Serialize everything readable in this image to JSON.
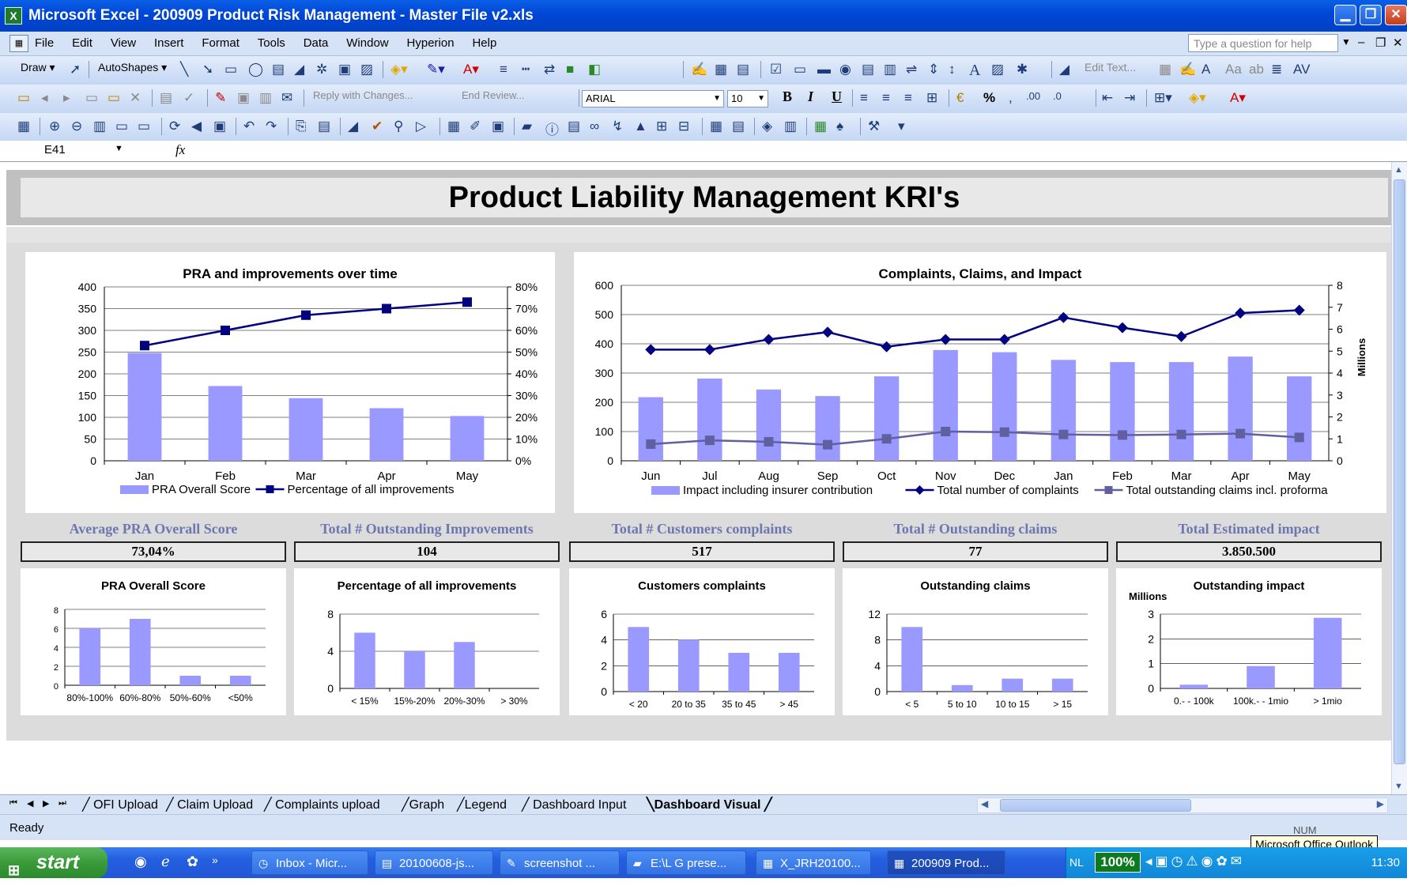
{
  "window": {
    "title": "Microsoft Excel - 200909 Product Risk Management - Master File v2.xls"
  },
  "menu": {
    "items": [
      "File",
      "Edit",
      "View",
      "Insert",
      "Format",
      "Tools",
      "Data",
      "Window",
      "Hyperion",
      "Help"
    ],
    "help_placeholder": "Type a question for help"
  },
  "toolbar": {
    "draw_label": "Draw",
    "autoshapes_label": "AutoShapes",
    "edit_text_label": "Edit Text...",
    "reply_label": "Reply with Changes...",
    "end_review_label": "End Review...",
    "font_name": "ARIAL",
    "font_size": "10",
    "bold_label": "B",
    "italic_label": "I",
    "underline_label": "U",
    "percent_label": "%"
  },
  "formula_bar": {
    "name_box": "E41",
    "fx_label": "fx"
  },
  "dashboard": {
    "title": "Product Liability Management KRI's",
    "kpis": [
      {
        "label": "Average PRA Overall Score",
        "value": "73,04%"
      },
      {
        "label": "Total # Outstanding Improvements",
        "value": "104"
      },
      {
        "label": "Total # Customers complaints",
        "value": "517"
      },
      {
        "label": "Total # Outstanding claims",
        "value": "77"
      },
      {
        "label": "Total Estimated impact",
        "value": "3.850.500"
      }
    ]
  },
  "chart_data": [
    {
      "id": "pra",
      "type": "bar+line",
      "title": "PRA and improvements over time",
      "categories": [
        "Jan",
        "Feb",
        "Mar",
        "Apr",
        "May"
      ],
      "series": [
        {
          "name": "PRA Overall Score",
          "type": "bar",
          "axis": "left",
          "values": [
            248,
            172,
            144,
            121,
            103
          ],
          "color": "#9999ff"
        },
        {
          "name": "Percentage of all improvements",
          "type": "line",
          "axis": "right",
          "values": [
            0.53,
            0.6,
            0.67,
            0.7,
            0.73
          ],
          "color": "#000080"
        }
      ],
      "y_left": {
        "min": 0,
        "max": 400,
        "step": 50,
        "ticks": [
          "0",
          "50",
          "100",
          "150",
          "200",
          "250",
          "300",
          "350",
          "400"
        ]
      },
      "y_right": {
        "min": 0,
        "max": 0.8,
        "step": 0.1,
        "ticks": [
          "0%",
          "10%",
          "20%",
          "30%",
          "40%",
          "50%",
          "60%",
          "70%",
          "80%"
        ]
      },
      "legend": "bottom"
    },
    {
      "id": "complaints",
      "type": "bar+line",
      "title": "Complaints, Claims, and Impact",
      "categories": [
        "Jun",
        "Jul",
        "Aug",
        "Sep",
        "Oct",
        "Nov",
        "Dec",
        "Jan",
        "Feb",
        "Mar",
        "Apr",
        "May"
      ],
      "series": [
        {
          "name": "Impact including insurer contribution",
          "type": "bar",
          "axis": "right",
          "values": [
            2.9,
            3.75,
            3.25,
            2.95,
            3.85,
            5.05,
            4.95,
            4.6,
            4.5,
            4.5,
            4.75,
            3.85
          ],
          "color": "#9999ff"
        },
        {
          "name": "Total number of complaints",
          "type": "line",
          "axis": "left",
          "values": [
            380,
            380,
            415,
            440,
            390,
            415,
            415,
            490,
            455,
            425,
            505,
            515
          ],
          "color": "#000080",
          "marker": "diamond"
        },
        {
          "name": "Total outstanding claims incl. proforma",
          "type": "line",
          "axis": "left",
          "values": [
            57,
            70,
            65,
            55,
            75,
            100,
            98,
            90,
            88,
            90,
            93,
            80
          ],
          "color": "#6060a0",
          "marker": "square"
        }
      ],
      "y_left": {
        "min": 0,
        "max": 600,
        "step": 100,
        "ticks": [
          "0",
          "100",
          "200",
          "300",
          "400",
          "500",
          "600"
        ]
      },
      "y_right": {
        "min": 0,
        "max": 8,
        "step": 1,
        "ticks": [
          "0",
          "1",
          "2",
          "3",
          "4",
          "5",
          "6",
          "7",
          "8"
        ],
        "label": "Millions"
      },
      "legend": "bottom"
    },
    {
      "id": "pra_dist",
      "type": "bar",
      "title": "PRA Overall Score",
      "categories": [
        "80%-100%",
        "60%-80%",
        "50%-60%",
        "<50%"
      ],
      "values": [
        6,
        7,
        1,
        1
      ],
      "ylim": [
        0,
        8
      ],
      "ticks": [
        "0",
        "2",
        "4",
        "6",
        "8"
      ]
    },
    {
      "id": "impr_dist",
      "type": "bar",
      "title": "Percentage of all improvements",
      "categories": [
        "< 15%",
        "15%-20%",
        "20%-30%",
        "> 30%"
      ],
      "values": [
        6,
        4,
        5,
        0
      ],
      "ylim": [
        0,
        8
      ],
      "ticks": [
        "0",
        "4",
        "8"
      ]
    },
    {
      "id": "compl_dist",
      "type": "bar",
      "title": "Customers complaints",
      "categories": [
        "< 20",
        "20 to 35",
        "35 to 45",
        "> 45"
      ],
      "values": [
        5,
        4,
        3,
        3
      ],
      "ylim": [
        0,
        6
      ],
      "ticks": [
        "0",
        "2",
        "4",
        "6"
      ]
    },
    {
      "id": "claims_dist",
      "type": "bar",
      "title": "Outstanding claims",
      "categories": [
        "< 5",
        "5 to 10",
        "10 to 15",
        "> 15"
      ],
      "values": [
        10,
        1,
        2,
        2
      ],
      "ylim": [
        0,
        12
      ],
      "ticks": [
        "0",
        "4",
        "8",
        "12"
      ]
    },
    {
      "id": "impact_dist",
      "type": "bar",
      "title": "Outstanding impact",
      "ylabel": "Millions",
      "categories": [
        "0.- - 100k",
        "100k.- - 1mio",
        "> 1mio"
      ],
      "values": [
        0.15,
        0.9,
        2.85
      ],
      "ylim": [
        0,
        3
      ],
      "ticks": [
        "0",
        "1",
        "2",
        "3"
      ]
    }
  ],
  "sheet_tabs": [
    "OFI Upload",
    "Claim Upload",
    "Complaints upload",
    "Graph",
    "Legend",
    "Dashboard Input",
    "Dashboard Visual"
  ],
  "active_sheet": "Dashboard Visual",
  "status": {
    "ready": "Ready",
    "num": "NUM",
    "tooltip": "Microsoft Office Outlook"
  },
  "taskbar": {
    "start_label": "start",
    "tasks": [
      "Inbox - Micr...",
      "20100608-js...",
      "screenshot ...",
      "E:\\L G prese...",
      "X_JRH20100...",
      "200909 Prod..."
    ],
    "language": "NL",
    "zoom": "100%",
    "clock": "11:30"
  }
}
